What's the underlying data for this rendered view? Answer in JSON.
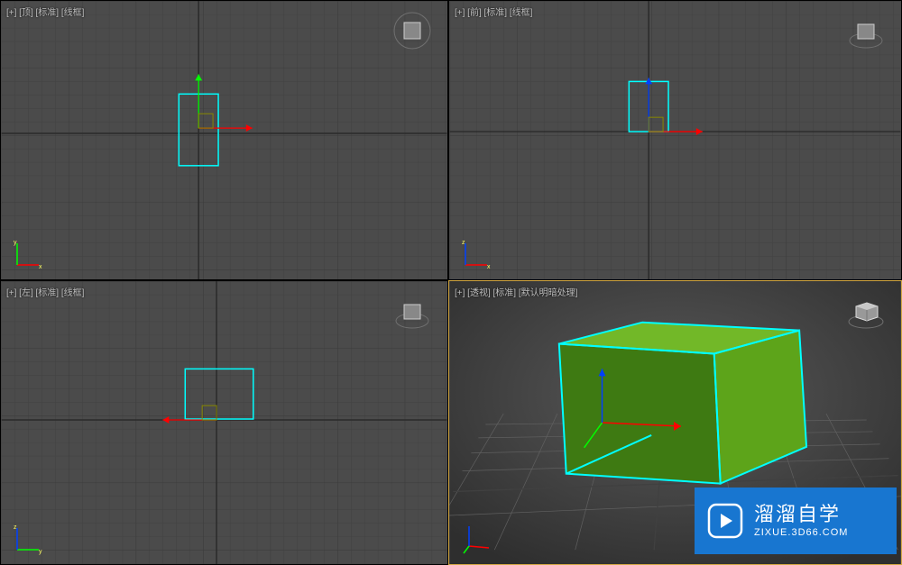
{
  "viewports": {
    "top": {
      "label": "[+] [顶] [标准] [线框]"
    },
    "front": {
      "label": "[+] [前] [标准] [线框]"
    },
    "left": {
      "label": "[+] [左] [标准] [线框]"
    },
    "perspective": {
      "label": "[+] [透视] [标准] [默认明暗处理]"
    }
  },
  "watermark": {
    "title": "溜溜自学",
    "url": "ZIXUE.3D66.COM"
  },
  "colors": {
    "bg": "#4b4b4b",
    "gridMinor": "#424242",
    "gridMajor": "#3a3a3a",
    "gridAxis": "#2a2a2a",
    "selection": "#00ffff",
    "axisX": "#ff0000",
    "axisY": "#00ff00",
    "axisZ": "#0000ff",
    "cubeFill": "#5da41a",
    "cubeSide": "#3e7a12",
    "cubeTop": "#72b828",
    "activeBorder": "#d4a843"
  },
  "object": {
    "type": "box",
    "selected": true
  }
}
